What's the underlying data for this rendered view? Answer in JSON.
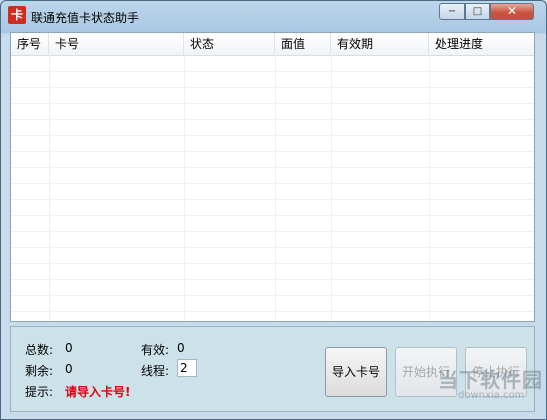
{
  "window": {
    "title": "联通充值卡状态助手",
    "icon": "app-logo-icon",
    "controls": {
      "minimize": "−",
      "maximize": "□",
      "close": "✕"
    }
  },
  "table": {
    "columns": [
      "序号",
      "卡号",
      "状态",
      "面值",
      "有效期",
      "处理进度"
    ],
    "rows": []
  },
  "stats": {
    "total_label": "总数:",
    "total_value": "0",
    "valid_label": "有效:",
    "valid_value": "0",
    "remaining_label": "剩余:",
    "remaining_value": "0",
    "threads_label": "线程:",
    "threads_value": "2",
    "hint_label": "提示:",
    "hint_value": "请导入卡号!"
  },
  "buttons": {
    "import": "导入卡号",
    "start": "开始执行",
    "stop": "停止执行"
  },
  "watermark": {
    "main": "当下软件园",
    "sub": "downxia.com"
  },
  "colors": {
    "hint": "#e0000e",
    "panel_bg": "#cde1e9",
    "close_button": "#c7523c"
  }
}
